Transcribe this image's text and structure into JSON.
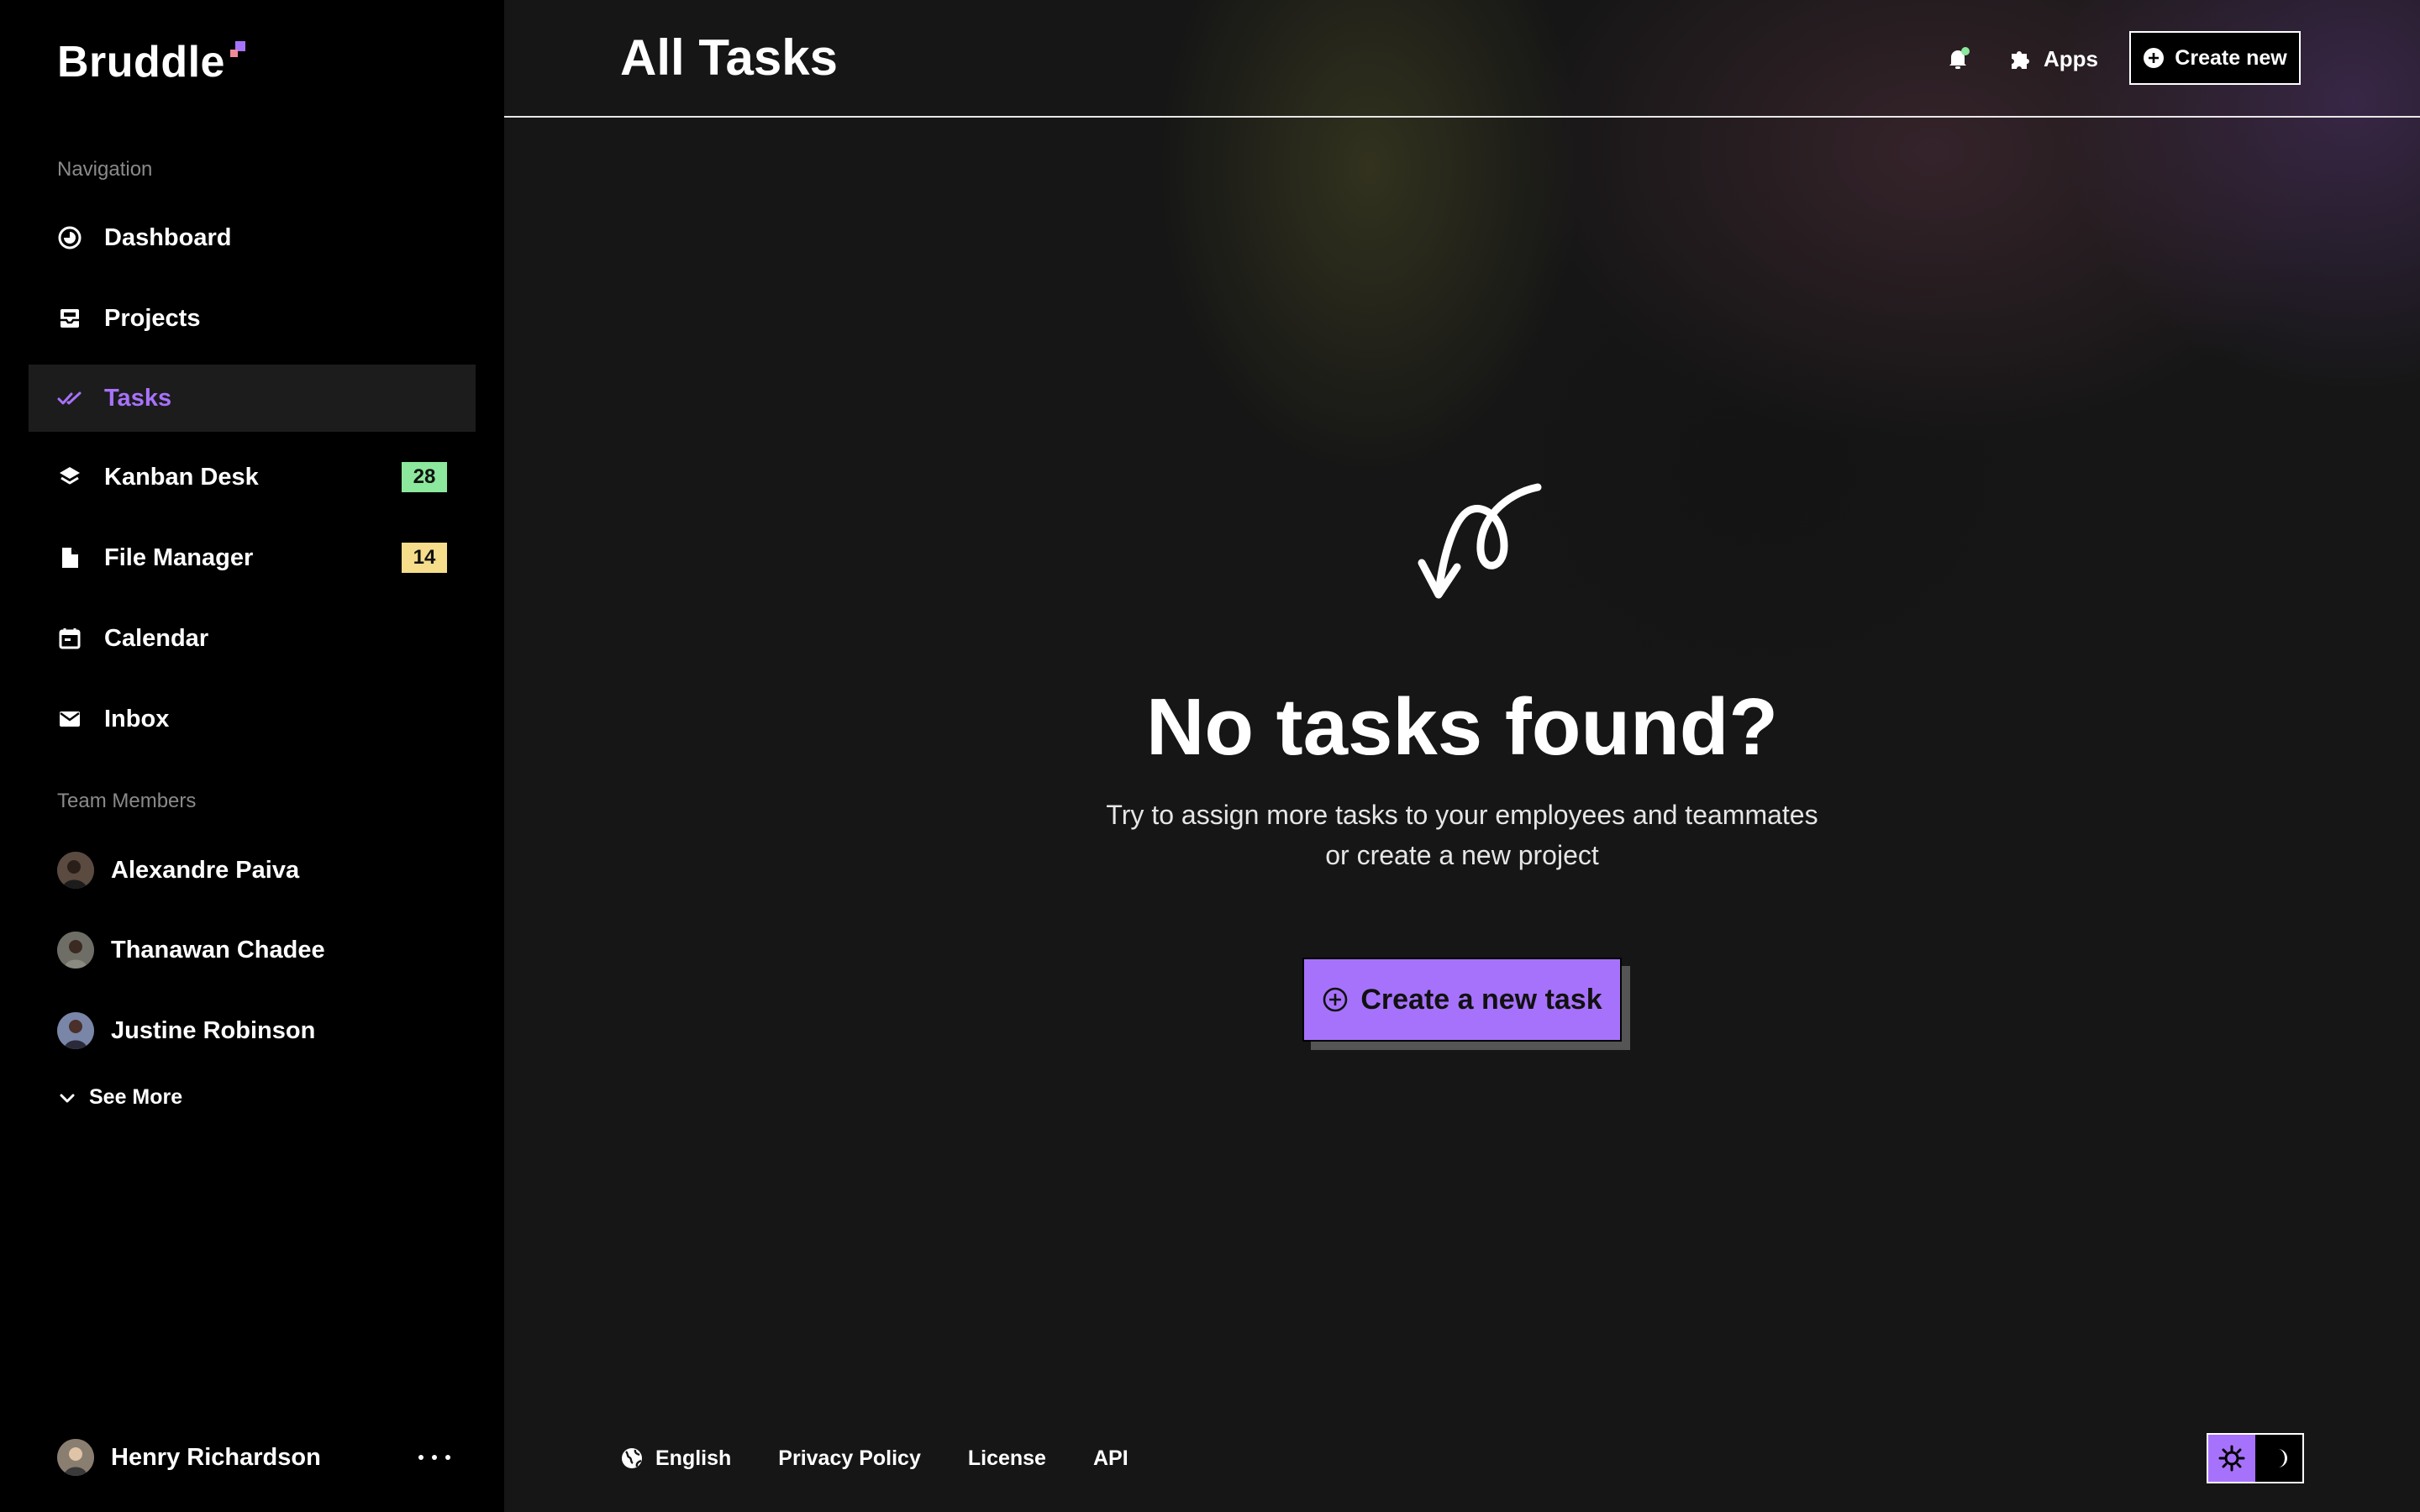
{
  "app": {
    "logo": "Bruddle"
  },
  "sidebar": {
    "navigation_label": "Navigation",
    "items": [
      {
        "label": "Dashboard",
        "icon": "dashboard-icon"
      },
      {
        "label": "Projects",
        "icon": "inbox-tray-icon"
      },
      {
        "label": "Tasks",
        "icon": "double-check-icon",
        "active": true
      },
      {
        "label": "Kanban Desk",
        "icon": "layers-icon",
        "badge": "28",
        "badge_color": "#8be89c"
      },
      {
        "label": "File Manager",
        "icon": "file-icon",
        "badge": "14",
        "badge_color": "#f5dd8b"
      },
      {
        "label": "Calendar",
        "icon": "calendar-icon"
      },
      {
        "label": "Inbox",
        "icon": "mail-icon"
      }
    ],
    "team_label": "Team Members",
    "members": [
      {
        "name": "Alexandre Paiva"
      },
      {
        "name": "Thanawan Chadee"
      },
      {
        "name": "Justine Robinson"
      }
    ],
    "see_more": "See More",
    "profile": {
      "name": "Henry Richardson"
    }
  },
  "header": {
    "title": "All Tasks",
    "apps_label": "Apps",
    "create_label": "Create new"
  },
  "empty_state": {
    "title": "No tasks found?",
    "subtitle_line1": "Try to assign more tasks to your employees and teammates",
    "subtitle_line2": "or create a new project",
    "cta_label": "Create a new task"
  },
  "footer": {
    "language": "English",
    "privacy": "Privacy Policy",
    "license": "License",
    "api": "API"
  },
  "colors": {
    "accent": "#a772fb",
    "sidebar_bg": "#000000",
    "main_bg": "#161616",
    "notification_dot": "#8be89c"
  }
}
